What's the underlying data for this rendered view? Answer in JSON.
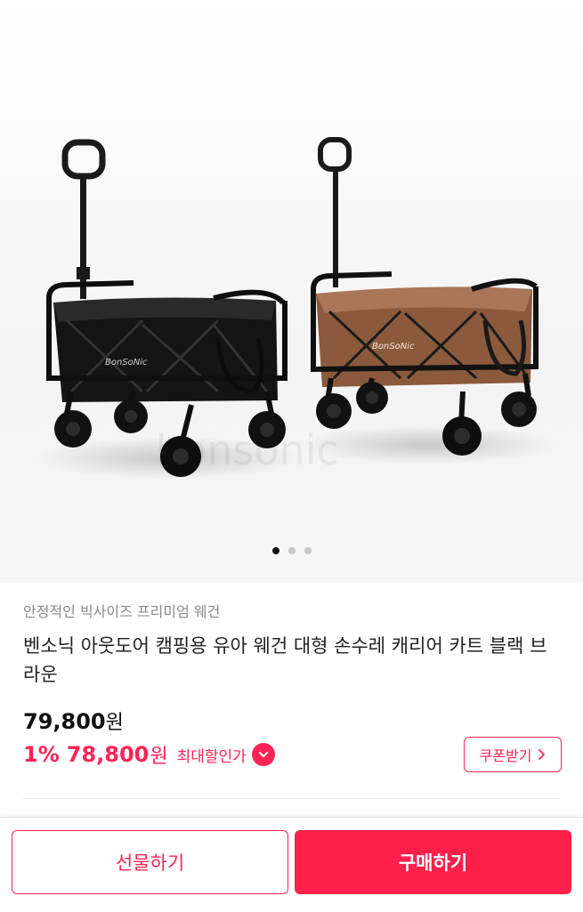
{
  "gallery": {
    "image_alt": "wagons-black-brown",
    "brand_print": "BonSoNic",
    "watermark": "bonsonic",
    "slides": 3,
    "active_slide": 1
  },
  "product": {
    "subtitle": "안정적인 빅사이즈 프리미엄 웨건",
    "title": "벤소닉 아웃도어 캠핑용 유아 웨건 대형 손수레 캐리어 카트 블랙 브라운",
    "price": "79,800",
    "price_unit": "원",
    "discount_rate": "1%",
    "sale_price": "78,800",
    "sale_unit": "원",
    "max_discount_label": "최대할인가",
    "coupon_button": "쿠폰받기"
  },
  "actions": {
    "gift_button": "선물하기",
    "buy_button": "구매하기"
  },
  "colors": {
    "accent": "#ff2455",
    "buy_bg": "#ff1f4b"
  }
}
